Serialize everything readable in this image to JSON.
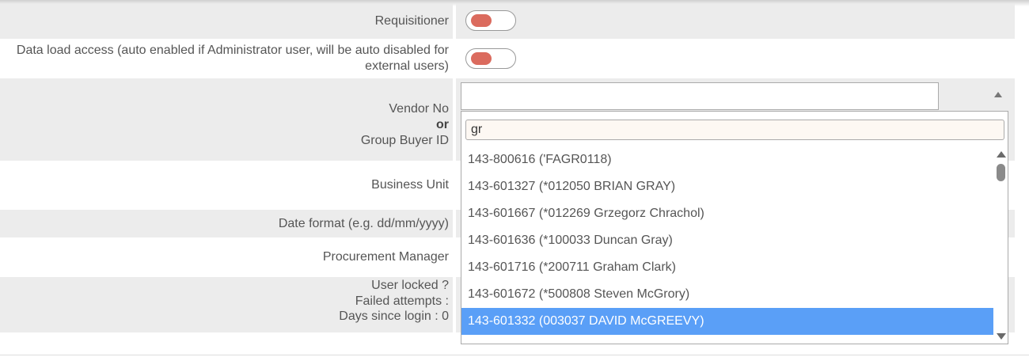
{
  "form": {
    "requisitioner_label": "Requisitioner",
    "data_load_label_line1": "Data load access (auto enabled if Administrator user, will be auto disabled for",
    "data_load_label_line2": "external users)",
    "vendor_no_label": "Vendor No",
    "or_label": "or",
    "group_buyer_label": "Group Buyer ID",
    "vendor_value": "",
    "business_unit_label": "Business Unit",
    "date_format_label": "Date format (e.g. dd/mm/yyyy)",
    "procurement_manager_label": "Procurement Manager",
    "user_locked_label": "User locked ?",
    "failed_attempts_label": "Failed attempts :",
    "days_since_login_label": "Days since login : 0"
  },
  "dropdown": {
    "search_value": "gr",
    "options": [
      {
        "label": "143-800616 ('FAGR0118)",
        "selected": false
      },
      {
        "label": "143-601327 (*012050 BRIAN GRAY)",
        "selected": false
      },
      {
        "label": "143-601667 (*012269 Grzegorz Chrachol)",
        "selected": false
      },
      {
        "label": "143-601636 (*100033 Duncan Gray)",
        "selected": false
      },
      {
        "label": "143-601716 (*200711 Graham Clark)",
        "selected": false
      },
      {
        "label": "143-601672 (*500808 Steven McGrory)",
        "selected": false
      },
      {
        "label": "143-601332 (003037 DAVID McGREEVY)",
        "selected": true
      }
    ]
  },
  "toggles": {
    "requisitioner_on": true,
    "data_load_on": true,
    "knob_color": "#db6b5e"
  },
  "colors": {
    "row_shade": "#ececec",
    "selected_option": "#5a9ff7"
  }
}
